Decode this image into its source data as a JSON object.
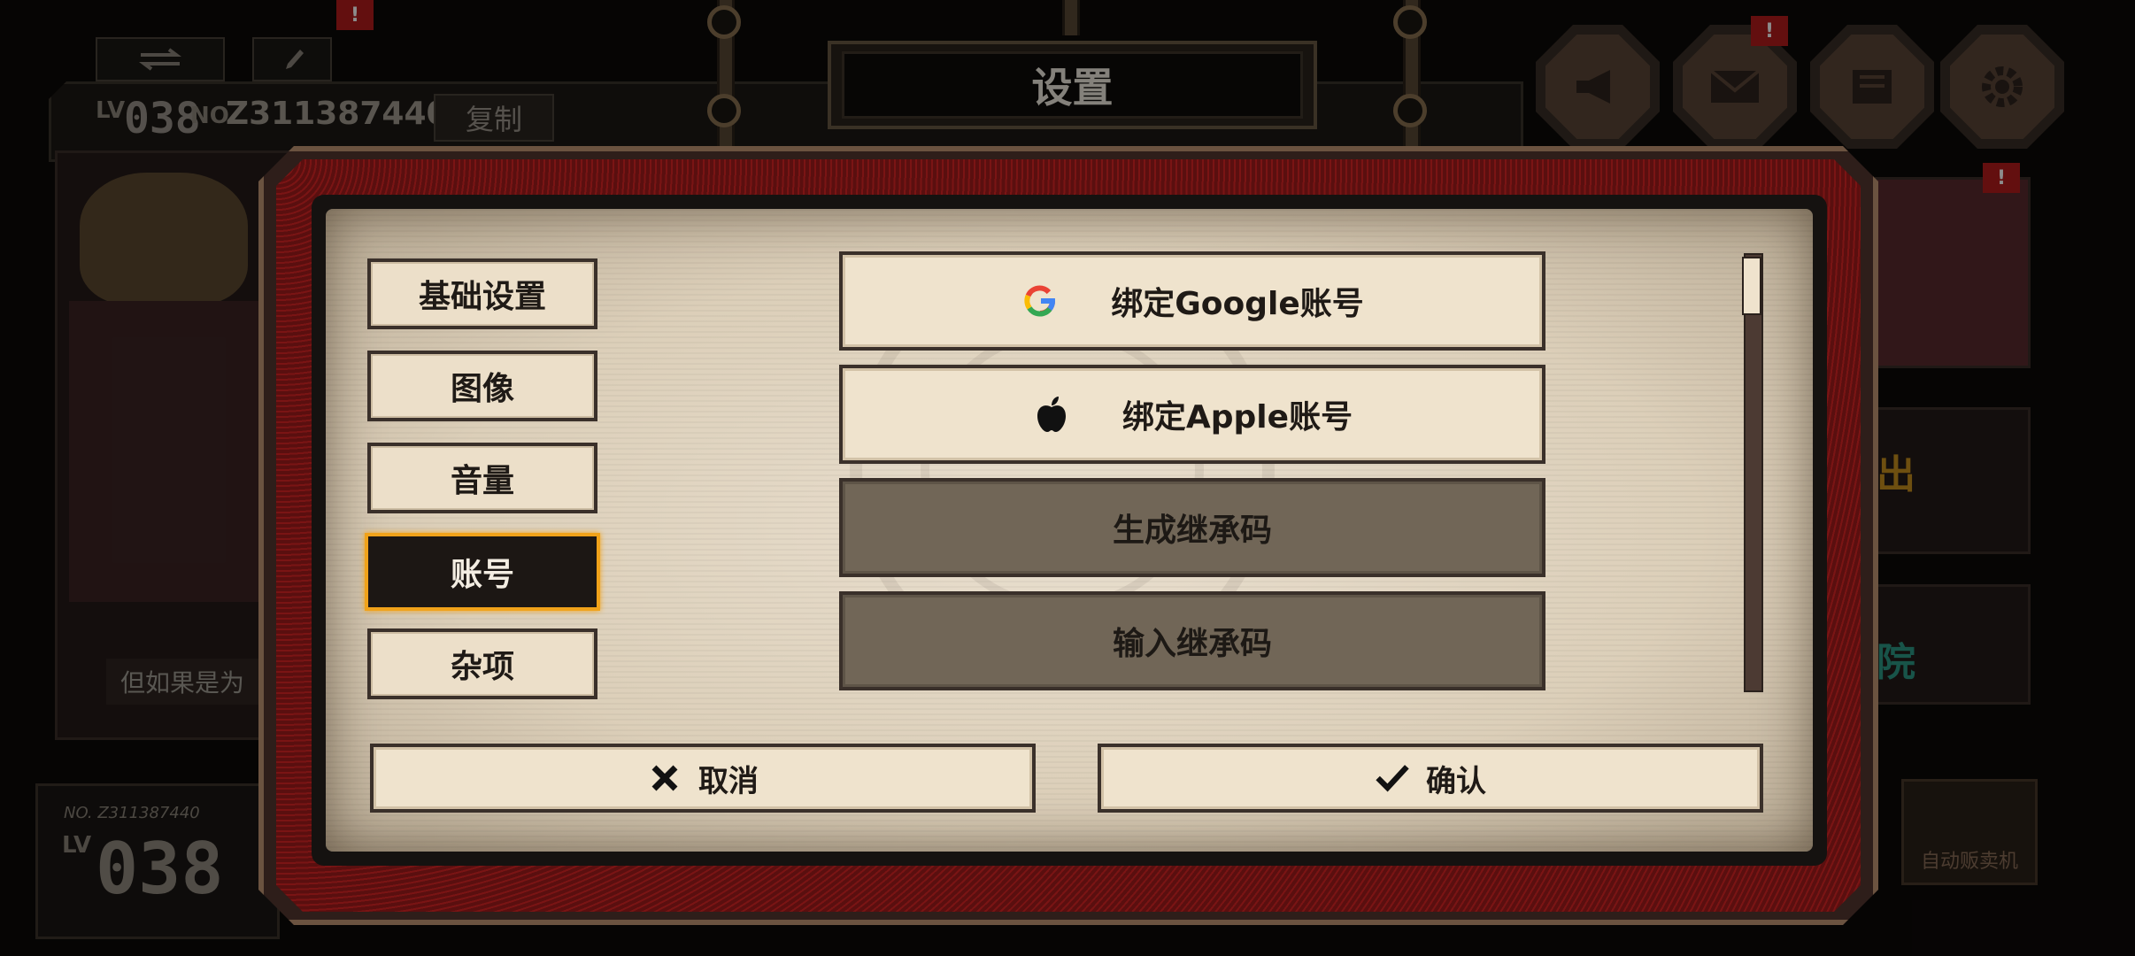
{
  "hud": {
    "lv_label": "LV",
    "level": "038",
    "no_label": "NO.",
    "player_no": "Z311387440",
    "copy_label": "复制",
    "alert_mark": "!",
    "caption": "但如果是为",
    "lv_card_no": "NO. Z311387440",
    "lv_card_lv": "LV",
    "lv_card_level": "038",
    "vending_machine_label": "自动贩卖机",
    "right_card_glyph_1": "出",
    "right_card_glyph_2": "院"
  },
  "dialog": {
    "title": "设置",
    "tabs": [
      {
        "label": "基础设置",
        "active": false
      },
      {
        "label": "图像",
        "active": false
      },
      {
        "label": "音量",
        "active": false
      },
      {
        "label": "账号",
        "active": true
      },
      {
        "label": "杂项",
        "active": false
      }
    ],
    "options": [
      {
        "label": "绑定Google账号",
        "icon": "google-icon",
        "enabled": true
      },
      {
        "label": "绑定Apple账号",
        "icon": "apple-icon",
        "enabled": true
      },
      {
        "label": "生成继承码",
        "enabled": false
      },
      {
        "label": "输入继承码",
        "enabled": false
      }
    ],
    "cancel_label": "取消",
    "confirm_label": "确认"
  },
  "colors": {
    "accent_active": "#f0a21a",
    "paper": "#efe3cd",
    "disabled": "#716657",
    "frame_red": "#7a1414"
  }
}
